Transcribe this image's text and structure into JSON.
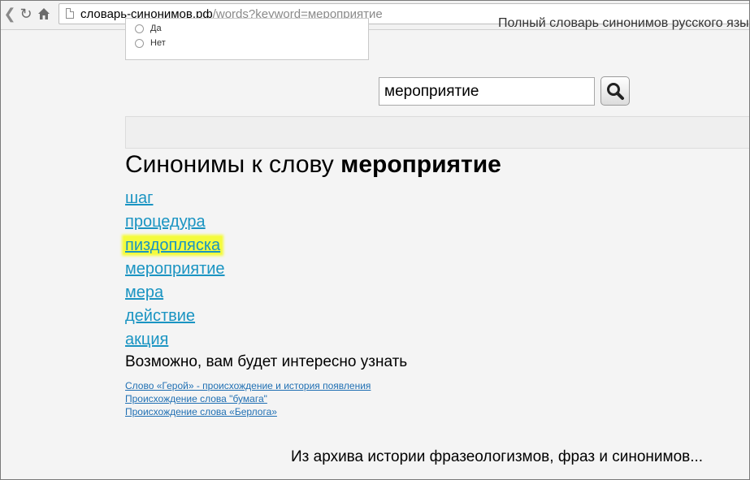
{
  "browser": {
    "url_host": "словарь-синонимов.рф",
    "url_path": "/words?keyword=мероприятие"
  },
  "poll": {
    "option_yes": "Да",
    "option_no": "Нет"
  },
  "tagline": "Полный словарь синонимов русского язы",
  "search": {
    "value": "мероприятие"
  },
  "heading": {
    "prefix": "Синонимы к слову ",
    "word": "мероприятие"
  },
  "synonyms": [
    "шаг",
    "процедура",
    "пиздопляска",
    "мероприятие",
    "мера",
    "действие",
    "акция"
  ],
  "highlight_color": "#f4fb3d",
  "link_color": "#1a94c2",
  "interest_title": "Возможно, вам будет интересно узнать",
  "related_links": [
    "Слово «Герой» - происхождение и история появления",
    "Происхождение слова \"бумага\"",
    "Происхождение слова «Берлога»"
  ],
  "archive_title": "Из архива истории фразеологизмов, фраз и синонимов..."
}
